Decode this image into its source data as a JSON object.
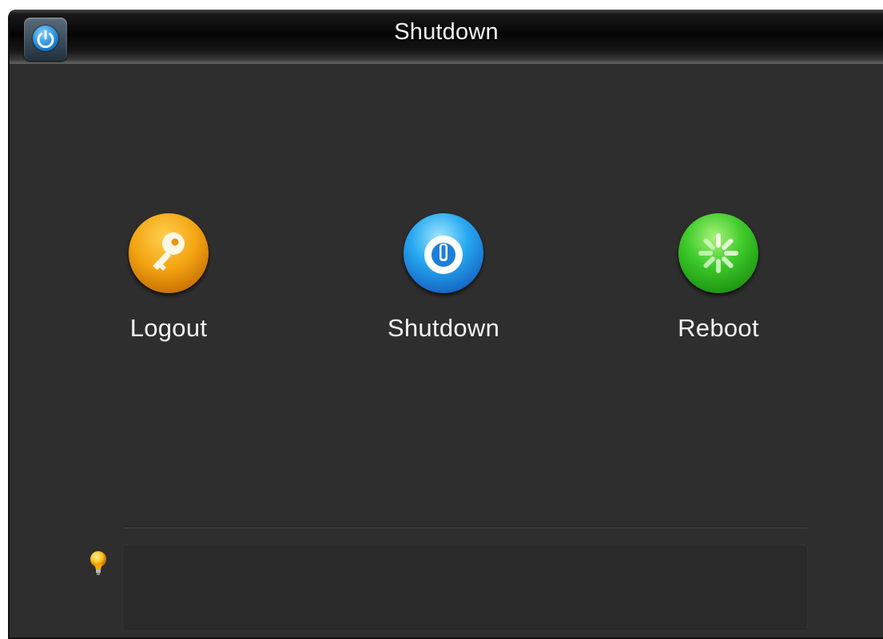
{
  "window": {
    "title": "Shutdown"
  },
  "titlebar": {
    "icon": "power-icon"
  },
  "actions": [
    {
      "label": "Logout",
      "icon": "key-icon",
      "color": "#f3a412"
    },
    {
      "label": "Shutdown",
      "icon": "power-icon",
      "color": "#26a8f0"
    },
    {
      "label": "Reboot",
      "icon": "spinner-icon",
      "color": "#3ecb2a"
    }
  ],
  "tips": {
    "icon": "lightbulb-icon",
    "text": ""
  }
}
